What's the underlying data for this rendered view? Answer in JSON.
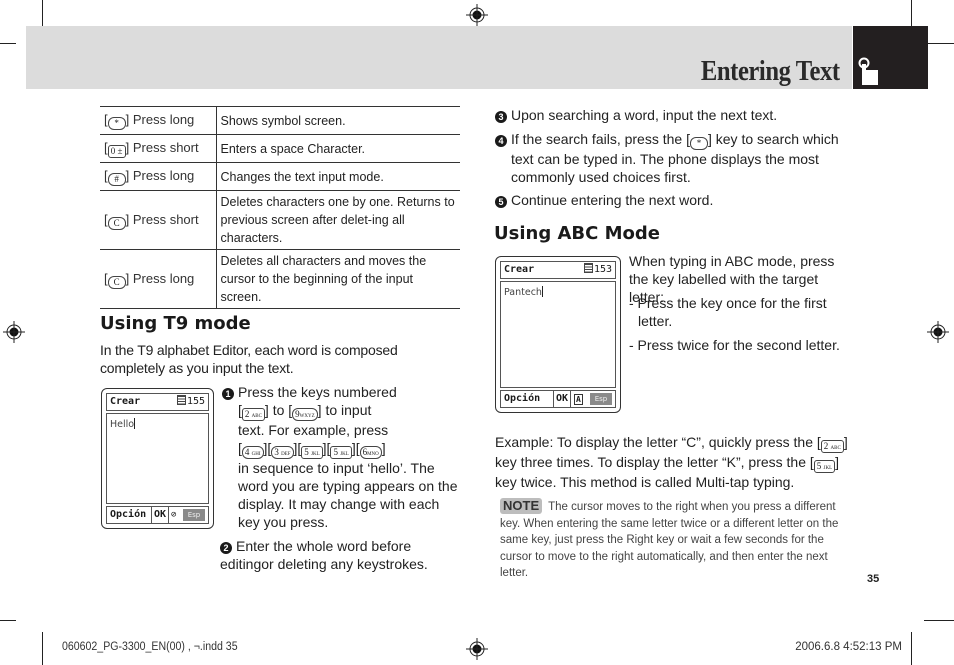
{
  "header": {
    "title": "Entering Text",
    "tab_icon": "hand-pointer-icon",
    "band_color": "#dcdcdc",
    "tab_color": "#231f20"
  },
  "key_table": {
    "rows": [
      {
        "key_icon": "star-key-icon",
        "key_glyph": "*",
        "action": "Press long",
        "description": "Shows symbol screen."
      },
      {
        "key_icon": "zero-key-icon",
        "key_glyph": "0 ±",
        "action": "Press short",
        "description": "Enters a space Character."
      },
      {
        "key_icon": "hash-key-icon",
        "key_glyph": "#",
        "action": "Press long",
        "description": "Changes the text input mode."
      },
      {
        "key_icon": "clear-key-icon",
        "key_glyph": "C",
        "action": "Press short",
        "description": "Deletes characters one by one. Returns to previous screen after delet-ing all characters."
      },
      {
        "key_icon": "clear-key-icon",
        "key_glyph": "C",
        "action": "Press long",
        "description": "Deletes all characters and moves the cursor to the beginning of the input screen."
      }
    ]
  },
  "t9": {
    "heading": "Using T9 mode",
    "intro": "In the T9 alphabet Editor, each word is composed completely as you input the text.",
    "phone": {
      "title": "Crear",
      "count": "155",
      "text": "Hello",
      "softkey_left": "Opción",
      "softkey_ok": "OK",
      "mode_icon": "t9-mode-icon",
      "mode_glyph": "⊘",
      "softkey_right": "Esp"
    },
    "step1": {
      "num": "1",
      "line1": "Press the keys numbered",
      "key_from": "2",
      "key_from_sub": "ABC",
      "to": "to",
      "key_to": "9",
      "key_to_sub": "WXYZ",
      "line2_end": "to input",
      "line3": "text. For example, press",
      "seq_keys": [
        {
          "digit": "4",
          "sub": "GHI"
        },
        {
          "digit": "3",
          "sub": "DEF"
        },
        {
          "digit": "5",
          "sub": "JKL"
        },
        {
          "digit": "5",
          "sub": "JKL"
        },
        {
          "digit": "6",
          "sub": "MNO"
        }
      ],
      "rest": "in sequence to input ‘hello’. The word you are typing appears on the display. It may change with each key you press."
    },
    "step2": {
      "num": "2",
      "text": "Enter the whole word before editingor deleting any keystrokes."
    }
  },
  "steps_right": {
    "step3": {
      "num": "3",
      "text": "Upon searching a word, input the next text."
    },
    "step4": {
      "num": "4",
      "before": "If the search fails, press the [",
      "key_glyph": "*",
      "after": "] key to search which text can be typed in. The phone displays the most commonly used choices first."
    },
    "step5": {
      "num": "5",
      "text": "Continue entering the next word."
    }
  },
  "abc": {
    "heading": "Using ABC Mode",
    "phone": {
      "title": "Crear",
      "count": "153",
      "text": "Pantech",
      "softkey_left": "Opción",
      "softkey_ok": "OK",
      "mode_icon": "abc-mode-icon",
      "mode_glyph": "A",
      "softkey_right": "Esp"
    },
    "intro": "When typing in ABC mode, press the key labelled with the target letter:",
    "bullet1": "- Press the key once for the first letter.",
    "bullet2": "- Press twice for the second letter.",
    "example": {
      "part1": "Example: To display the letter “C”, quickly press the [",
      "key1": "2",
      "key1_sub": "ABC",
      "part2": "] key three times. To display the letter “K”, press the [",
      "key2": "5",
      "key2_sub": "JKL",
      "part3": "] key twice. This method is called Multi-tap typing."
    },
    "note": {
      "badge": "NOTE",
      "text": "The cursor moves to the right when you press a different key. When entering the same letter twice or a different letter on the same key, just press the Right key or wait a few seconds for the cursor to move to the right automatically, and then enter the next letter."
    }
  },
  "page_number": "35",
  "footer": {
    "left": "060602_PG-3300_EN(00) , ¬.indd   35",
    "right": "2006.6.8   4:52:13 PM"
  }
}
